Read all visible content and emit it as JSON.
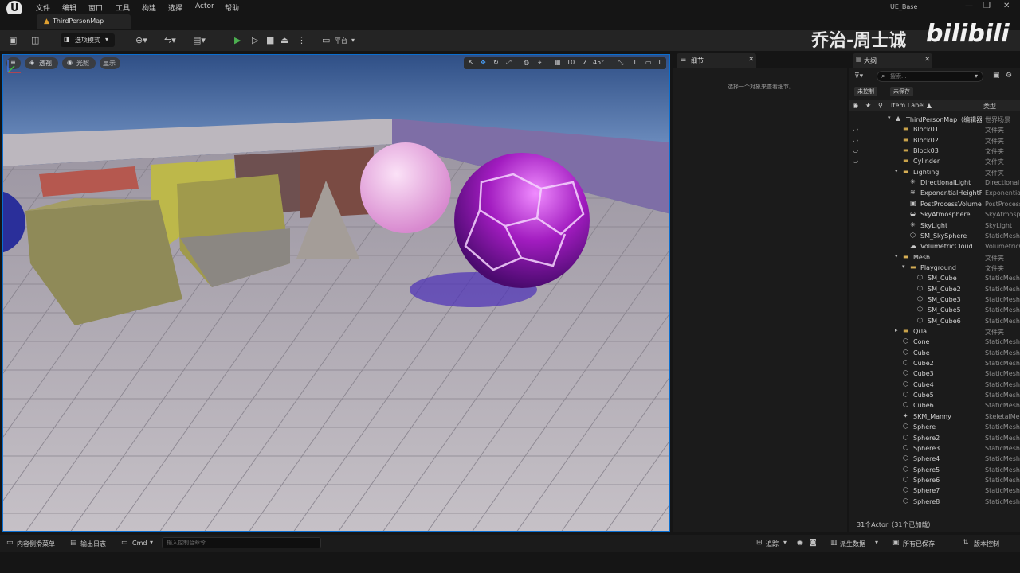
{
  "window": {
    "project": "UE_Base",
    "menu": [
      "文件",
      "编辑",
      "窗口",
      "工具",
      "构建",
      "选择",
      "Actor",
      "帮助"
    ],
    "controls": [
      "—",
      "❐",
      "✕"
    ]
  },
  "document_tab": {
    "label": "ThirdPersonMap"
  },
  "toolbar": {
    "mode_label": "选项模式",
    "platform_label": "平台"
  },
  "watermark": {
    "text": "乔治-周士诚",
    "brand": "bilibili"
  },
  "viewport": {
    "perspective_label": "透视",
    "lit_label": "光照",
    "show_label": "显示",
    "grid_snap": "10",
    "rotation_snap": "45°",
    "scale_snap": "1",
    "camera_speed": "1"
  },
  "details": {
    "title": "细节",
    "close": "✕",
    "empty_hint": "选择一个对象来查看细节。"
  },
  "outliner": {
    "title": "大纲",
    "close": "✕",
    "search_placeholder": "搜索...",
    "chip_uncontrolled": "未控制",
    "chip_unsaved": "未保存",
    "col_label": "Item Label ▲",
    "col_type": "类型",
    "rows": [
      {
        "label": "ThirdPersonMap（编辑器）",
        "type": "世界场景",
        "kind": "world",
        "indent": 0,
        "expand": "▾",
        "eye": ""
      },
      {
        "label": "Block01",
        "type": "文件夹",
        "kind": "folder",
        "indent": 1,
        "expand": "",
        "eye": "◡"
      },
      {
        "label": "Block02",
        "type": "文件夹",
        "kind": "folder",
        "indent": 1,
        "expand": "",
        "eye": "◡"
      },
      {
        "label": "Block03",
        "type": "文件夹",
        "kind": "folder",
        "indent": 1,
        "expand": "",
        "eye": "◡"
      },
      {
        "label": "Cylinder",
        "type": "文件夹",
        "kind": "folder",
        "indent": 1,
        "expand": "",
        "eye": "◡"
      },
      {
        "label": "Lighting",
        "type": "文件夹",
        "kind": "folder-open",
        "indent": 1,
        "expand": "▾",
        "eye": ""
      },
      {
        "label": "DirectionalLight",
        "type": "DirectionalLight",
        "kind": "light",
        "indent": 2,
        "expand": "",
        "eye": ""
      },
      {
        "label": "ExponentialHeightFog",
        "type": "ExponentialHeightFog",
        "kind": "fog",
        "indent": 2,
        "expand": "",
        "eye": ""
      },
      {
        "label": "PostProcessVolume",
        "type": "PostProcessVolume",
        "kind": "volume",
        "indent": 2,
        "expand": "",
        "eye": ""
      },
      {
        "label": "SkyAtmosphere",
        "type": "SkyAtmosphere",
        "kind": "sky",
        "indent": 2,
        "expand": "",
        "eye": ""
      },
      {
        "label": "SkyLight",
        "type": "SkyLight",
        "kind": "light",
        "indent": 2,
        "expand": "",
        "eye": ""
      },
      {
        "label": "SM_SkySphere",
        "type": "StaticMeshActor",
        "kind": "mesh",
        "indent": 2,
        "expand": "",
        "eye": ""
      },
      {
        "label": "VolumetricCloud",
        "type": "VolumetricCloud",
        "kind": "cloud",
        "indent": 2,
        "expand": "",
        "eye": ""
      },
      {
        "label": "Mesh",
        "type": "文件夹",
        "kind": "folder-open",
        "indent": 1,
        "expand": "▾",
        "eye": ""
      },
      {
        "label": "Playground",
        "type": "文件夹",
        "kind": "folder-open",
        "indent": 2,
        "expand": "▾",
        "eye": ""
      },
      {
        "label": "SM_Cube",
        "type": "StaticMeshActor",
        "kind": "mesh",
        "indent": 3,
        "expand": "",
        "eye": ""
      },
      {
        "label": "SM_Cube2",
        "type": "StaticMeshActor",
        "kind": "mesh",
        "indent": 3,
        "expand": "",
        "eye": ""
      },
      {
        "label": "SM_Cube3",
        "type": "StaticMeshActor",
        "kind": "mesh",
        "indent": 3,
        "expand": "",
        "eye": ""
      },
      {
        "label": "SM_Cube5",
        "type": "StaticMeshActor",
        "kind": "mesh",
        "indent": 3,
        "expand": "",
        "eye": ""
      },
      {
        "label": "SM_Cube6",
        "type": "StaticMeshActor",
        "kind": "mesh",
        "indent": 3,
        "expand": "",
        "eye": ""
      },
      {
        "label": "QiTa",
        "type": "文件夹",
        "kind": "folder",
        "indent": 1,
        "expand": "▸",
        "eye": ""
      },
      {
        "label": "Cone",
        "type": "StaticMeshActor",
        "kind": "mesh",
        "indent": 1,
        "expand": "",
        "eye": ""
      },
      {
        "label": "Cube",
        "type": "StaticMeshActor",
        "kind": "mesh",
        "indent": 1,
        "expand": "",
        "eye": ""
      },
      {
        "label": "Cube2",
        "type": "StaticMeshActor",
        "kind": "mesh",
        "indent": 1,
        "expand": "",
        "eye": ""
      },
      {
        "label": "Cube3",
        "type": "StaticMeshActor",
        "kind": "mesh",
        "indent": 1,
        "expand": "",
        "eye": ""
      },
      {
        "label": "Cube4",
        "type": "StaticMeshActor",
        "kind": "mesh",
        "indent": 1,
        "expand": "",
        "eye": ""
      },
      {
        "label": "Cube5",
        "type": "StaticMeshActor",
        "kind": "mesh",
        "indent": 1,
        "expand": "",
        "eye": ""
      },
      {
        "label": "Cube6",
        "type": "StaticMeshActor",
        "kind": "mesh",
        "indent": 1,
        "expand": "",
        "eye": ""
      },
      {
        "label": "SKM_Manny",
        "type": "SkeletalMeshActor",
        "kind": "skeletal",
        "indent": 1,
        "expand": "",
        "eye": ""
      },
      {
        "label": "Sphere",
        "type": "StaticMeshActor",
        "kind": "mesh",
        "indent": 1,
        "expand": "",
        "eye": ""
      },
      {
        "label": "Sphere2",
        "type": "StaticMeshActor",
        "kind": "mesh",
        "indent": 1,
        "expand": "",
        "eye": ""
      },
      {
        "label": "Sphere3",
        "type": "StaticMeshActor",
        "kind": "mesh",
        "indent": 1,
        "expand": "",
        "eye": ""
      },
      {
        "label": "Sphere4",
        "type": "StaticMeshActor",
        "kind": "mesh",
        "indent": 1,
        "expand": "",
        "eye": ""
      },
      {
        "label": "Sphere5",
        "type": "StaticMeshActor",
        "kind": "mesh",
        "indent": 1,
        "expand": "",
        "eye": ""
      },
      {
        "label": "Sphere6",
        "type": "StaticMeshActor",
        "kind": "mesh",
        "indent": 1,
        "expand": "",
        "eye": ""
      },
      {
        "label": "Sphere7",
        "type": "StaticMeshActor",
        "kind": "mesh",
        "indent": 1,
        "expand": "",
        "eye": ""
      },
      {
        "label": "Sphere8",
        "type": "StaticMeshActor",
        "kind": "mesh",
        "indent": 1,
        "expand": "",
        "eye": ""
      }
    ],
    "footer": "31个Actor（31个已加载）"
  },
  "statusbar": {
    "content_drawer": "内容侧滑菜单",
    "output_log": "输出日志",
    "cmd": "Cmd",
    "cmd_placeholder": "输入控制台命令",
    "trace": "追踪",
    "derived_data": "派生数据",
    "all_saved": "所有已保存",
    "source_control": "版本控制"
  },
  "colors": {
    "accent": "#0a6ed0",
    "play_green": "#4caf50",
    "folder": "#c9a24a",
    "panel": "#1b1b1b"
  }
}
